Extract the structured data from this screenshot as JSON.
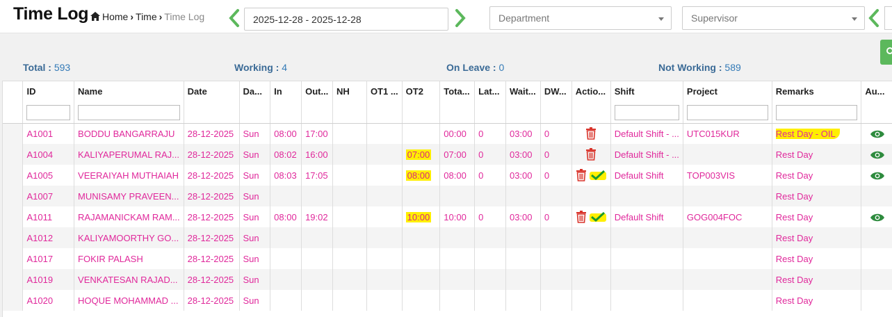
{
  "header": {
    "title": "Time Log",
    "breadcrumb": [
      "Home",
      "Time",
      "Time Log"
    ],
    "date_range": "2025-12-28 - 2025-12-28",
    "department_placeholder": "Department",
    "supervisor_placeholder": "Supervisor"
  },
  "stats": [
    {
      "label": "Total :",
      "value": "593"
    },
    {
      "label": "Working :",
      "value": "4"
    },
    {
      "label": "On Leave :",
      "value": "0"
    },
    {
      "label": "Not Working :",
      "value": "589"
    }
  ],
  "table": {
    "columns": [
      "ID",
      "Name",
      "Date",
      "Da...",
      "In",
      "Out...",
      "NH",
      "OT1 ...",
      "OT2",
      "Tota...",
      "Lat...",
      "Wait...",
      "DW...",
      "Actio...",
      "Shift",
      "Project",
      "Remarks",
      "Au..."
    ],
    "rows": [
      {
        "id": "A1001",
        "name": "BODDU BANGARRAJU",
        "date": "28-12-2025",
        "day": "Sun",
        "in": "08:00",
        "out": "17:00",
        "nh": "",
        "ot1": "",
        "ot2": "",
        "total": "00:00",
        "late": "0",
        "wait": "03:00",
        "dw": "0",
        "actions": [
          "delete"
        ],
        "shift": "Default Shift - ...",
        "project": "UTC015KUR",
        "remarks": "Rest Day - OIL",
        "audit": true
      },
      {
        "id": "A1004",
        "name": "KALIYAPERUMAL RAJ...",
        "date": "28-12-2025",
        "day": "Sun",
        "in": "08:02",
        "out": "16:00",
        "nh": "",
        "ot1": "",
        "ot2": "07:00",
        "total": "07:00",
        "late": "0",
        "wait": "03:00",
        "dw": "0",
        "actions": [
          "delete"
        ],
        "shift": "Default Shift - ...",
        "project": "",
        "remarks": "Rest Day",
        "audit": true
      },
      {
        "id": "A1005",
        "name": "VEERAIYAH MUTHAIAH",
        "date": "28-12-2025",
        "day": "Sun",
        "in": "08:03",
        "out": "17:05",
        "nh": "",
        "ot1": "",
        "ot2": "08:00",
        "total": "08:00",
        "late": "0",
        "wait": "03:00",
        "dw": "0",
        "actions": [
          "delete",
          "approve"
        ],
        "shift": "Default Shift",
        "project": "TOP003VIS",
        "remarks": "Rest Day",
        "audit": true
      },
      {
        "id": "A1007",
        "name": "MUNISAMY PRAVEEN...",
        "date": "28-12-2025",
        "day": "Sun",
        "in": "",
        "out": "",
        "nh": "",
        "ot1": "",
        "ot2": "",
        "total": "",
        "late": "",
        "wait": "",
        "dw": "",
        "actions": [],
        "shift": "",
        "project": "",
        "remarks": "Rest Day",
        "audit": false
      },
      {
        "id": "A1011",
        "name": "RAJAMANICKAM RAM...",
        "date": "28-12-2025",
        "day": "Sun",
        "in": "08:00",
        "out": "19:02",
        "nh": "",
        "ot1": "",
        "ot2": "10:00",
        "total": "10:00",
        "late": "0",
        "wait": "03:00",
        "dw": "0",
        "actions": [
          "delete",
          "approve"
        ],
        "shift": "Default Shift",
        "project": "GOG004FOC",
        "remarks": "Rest Day",
        "audit": true
      },
      {
        "id": "A1012",
        "name": "KALIYAMOORTHY GO...",
        "date": "28-12-2025",
        "day": "Sun",
        "in": "",
        "out": "",
        "nh": "",
        "ot1": "",
        "ot2": "",
        "total": "",
        "late": "",
        "wait": "",
        "dw": "",
        "actions": [],
        "shift": "",
        "project": "",
        "remarks": "Rest Day",
        "audit": false
      },
      {
        "id": "A1017",
        "name": "FOKIR PALASH",
        "date": "28-12-2025",
        "day": "Sun",
        "in": "",
        "out": "",
        "nh": "",
        "ot1": "",
        "ot2": "",
        "total": "",
        "late": "",
        "wait": "",
        "dw": "",
        "actions": [],
        "shift": "",
        "project": "",
        "remarks": "Rest Day",
        "audit": false
      },
      {
        "id": "A1019",
        "name": "VENKATESAN RAJAD...",
        "date": "28-12-2025",
        "day": "Sun",
        "in": "",
        "out": "",
        "nh": "",
        "ot1": "",
        "ot2": "",
        "total": "",
        "late": "",
        "wait": "",
        "dw": "",
        "actions": [],
        "shift": "",
        "project": "",
        "remarks": "Rest Day",
        "audit": false
      },
      {
        "id": "A1020",
        "name": "HOQUE MOHAMMAD ...",
        "date": "28-12-2025",
        "day": "Sun",
        "in": "",
        "out": "",
        "nh": "",
        "ot1": "",
        "ot2": "",
        "total": "",
        "late": "",
        "wait": "",
        "dw": "",
        "actions": [],
        "shift": "",
        "project": "",
        "remarks": "Rest Day",
        "audit": false
      }
    ]
  },
  "colors": {
    "accent": "#5cb85c",
    "text_pink": "#e0289b",
    "danger": "#d9342b",
    "highlight": "#ffef00",
    "eye": "#2e8b3e"
  }
}
